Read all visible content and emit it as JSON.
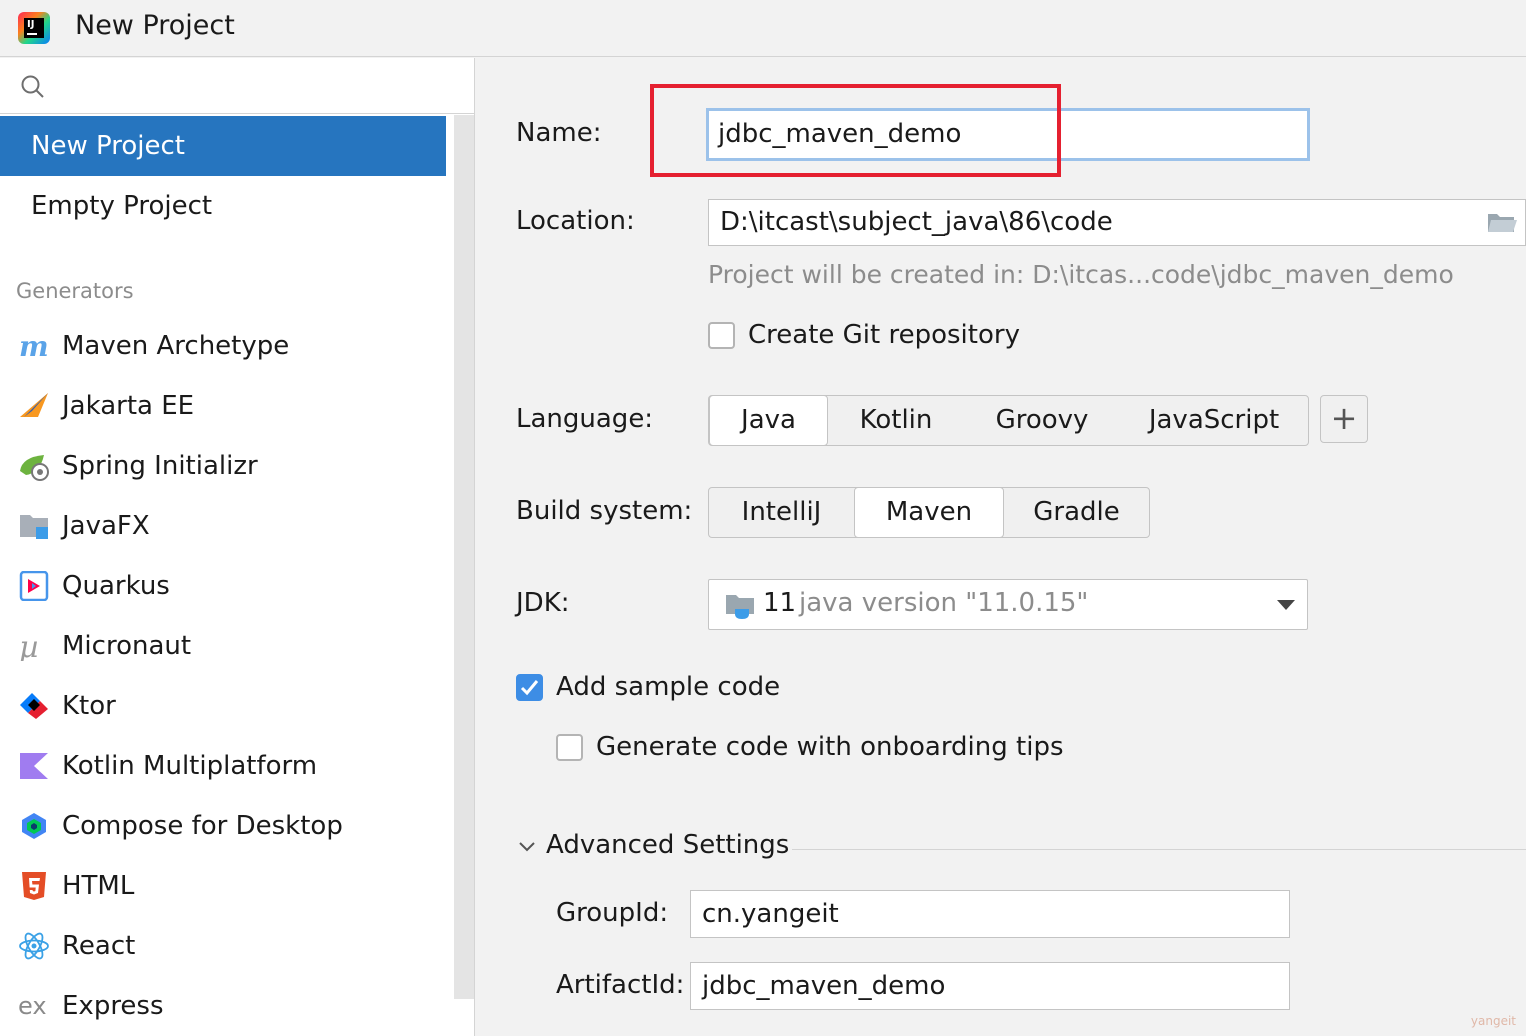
{
  "window": {
    "title": "New Project",
    "app_icon": "intellij-idea-logo",
    "app_icon_text": "IJ"
  },
  "sidebar": {
    "search_placeholder": "",
    "top_items": [
      {
        "label": "New Project",
        "selected": true
      },
      {
        "label": "Empty Project",
        "selected": false
      }
    ],
    "section_label": "Generators",
    "generators": [
      {
        "label": "Maven Archetype",
        "icon": "maven-icon"
      },
      {
        "label": "Jakarta EE",
        "icon": "jakarta-ee-icon"
      },
      {
        "label": "Spring Initializr",
        "icon": "spring-icon"
      },
      {
        "label": "JavaFX",
        "icon": "javafx-icon"
      },
      {
        "label": "Quarkus",
        "icon": "quarkus-icon"
      },
      {
        "label": "Micronaut",
        "icon": "micronaut-icon"
      },
      {
        "label": "Ktor",
        "icon": "ktor-icon"
      },
      {
        "label": "Kotlin Multiplatform",
        "icon": "kotlin-icon"
      },
      {
        "label": "Compose for Desktop",
        "icon": "compose-icon"
      },
      {
        "label": "HTML",
        "icon": "html5-icon"
      },
      {
        "label": "React",
        "icon": "react-icon"
      },
      {
        "label": "Express",
        "icon": "express-icon"
      }
    ]
  },
  "form": {
    "name": {
      "label": "Name:",
      "value": "jdbc_maven_demo"
    },
    "location": {
      "label": "Location:",
      "value": "D:\\itcast\\subject_java\\86\\code",
      "hint": "Project will be created in: D:\\itcas...code\\jdbc_maven_demo"
    },
    "git": {
      "label": "Create Git repository",
      "checked": false
    },
    "language": {
      "label": "Language:",
      "options": [
        "Java",
        "Kotlin",
        "Groovy",
        "JavaScript"
      ],
      "selected": "Java",
      "add_label": "+"
    },
    "build_system": {
      "label": "Build system:",
      "options": [
        "IntelliJ",
        "Maven",
        "Gradle"
      ],
      "selected": "Maven"
    },
    "jdk": {
      "label": "JDK:",
      "version": "11",
      "description": "java version \"11.0.15\""
    },
    "sample_code": {
      "label": "Add sample code",
      "checked": true
    },
    "onboarding": {
      "label": "Generate code with onboarding tips",
      "checked": false
    },
    "advanced": {
      "label": "Advanced Settings",
      "expanded": true,
      "group_id": {
        "label": "GroupId:",
        "value": "cn.yangeit"
      },
      "artifact_id": {
        "label": "ArtifactId:",
        "value": "jdbc_maven_demo"
      }
    }
  },
  "annotation": {
    "highlight_color": "#e52030"
  },
  "watermark": "yangeit",
  "colors": {
    "selection": "#2675bf",
    "checkbox_checked": "#3d8de5",
    "focus_border": "#9cc2ea"
  }
}
